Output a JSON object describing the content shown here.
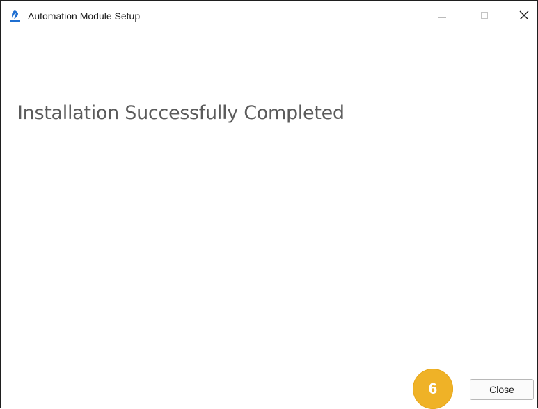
{
  "window": {
    "title": "Automation Module Setup",
    "icon": "setup-app-icon",
    "controls": {
      "minimize_icon": "minimize-icon",
      "maximize_icon": "maximize-icon",
      "close_icon": "close-icon"
    }
  },
  "main": {
    "heading": "Installation Successfully Completed"
  },
  "annotation": {
    "step_number": "6",
    "color": "#efb227"
  },
  "footer": {
    "close_label": "Close"
  }
}
